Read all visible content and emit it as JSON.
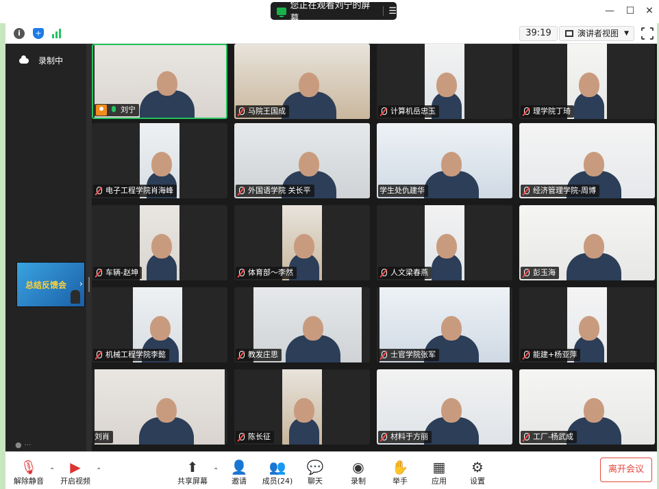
{
  "titlebar": {
    "share_banner": "您正在观看刘宁的屏幕",
    "share_banner_icon": "screen-share-icon",
    "menu_icon": "list-icon",
    "window_controls": [
      "minimize-icon",
      "maximize-icon",
      "close-icon"
    ]
  },
  "toolbar": {
    "timer": "39:19",
    "view_mode": "演讲者视图",
    "icons": [
      "info-icon",
      "shield-icon",
      "signal-icon",
      "fullscreen-icon"
    ]
  },
  "sidebar": {
    "recording_label": "录制中",
    "thumbnail_title": "总结反馈会"
  },
  "tiles": [
    {
      "name": "刘宁",
      "mic": "on",
      "active": true,
      "badge": true
    },
    {
      "name": "马院王国成",
      "mic": "off"
    },
    {
      "name": "计算机岳忠玉",
      "mic": "off"
    },
    {
      "name": "理学院丁琦",
      "mic": "off"
    },
    {
      "name": "电子工程学院肖海峰",
      "mic": "off"
    },
    {
      "name": "外国语学院 关长平",
      "mic": "off"
    },
    {
      "name": "学生处仇建华",
      "mic": "none"
    },
    {
      "name": "经济管理学院-周博",
      "mic": "off"
    },
    {
      "name": "车辆-赵坤",
      "mic": "off"
    },
    {
      "name": "体育部～李然",
      "mic": "off"
    },
    {
      "name": "人文梁春燕",
      "mic": "off"
    },
    {
      "name": "彭玉海",
      "mic": "off"
    },
    {
      "name": "机械工程学院李懿",
      "mic": "off"
    },
    {
      "name": "教发庄思",
      "mic": "off"
    },
    {
      "name": "士官学院张军",
      "mic": "off"
    },
    {
      "name": "能建+杨亚萍",
      "mic": "off"
    },
    {
      "name": "刘肖",
      "mic": "none"
    },
    {
      "name": "陈长征",
      "mic": "off"
    },
    {
      "name": "材料于方丽",
      "mic": "off"
    },
    {
      "name": "工厂-杨武成",
      "mic": "off"
    }
  ],
  "bottom": {
    "unmute": "解除静音",
    "start_video": "开启视频",
    "share_screen": "共享屏幕",
    "invite": "邀请",
    "members": "成员(24)",
    "chat": "聊天",
    "record": "录制",
    "raise_hand": "举手",
    "apps": "应用",
    "settings": "设置",
    "leave": "离开会议"
  },
  "colors": {
    "accent_green": "#23c35f",
    "leave_red": "#e3463c",
    "stage_bg": "#1a1a1a"
  }
}
